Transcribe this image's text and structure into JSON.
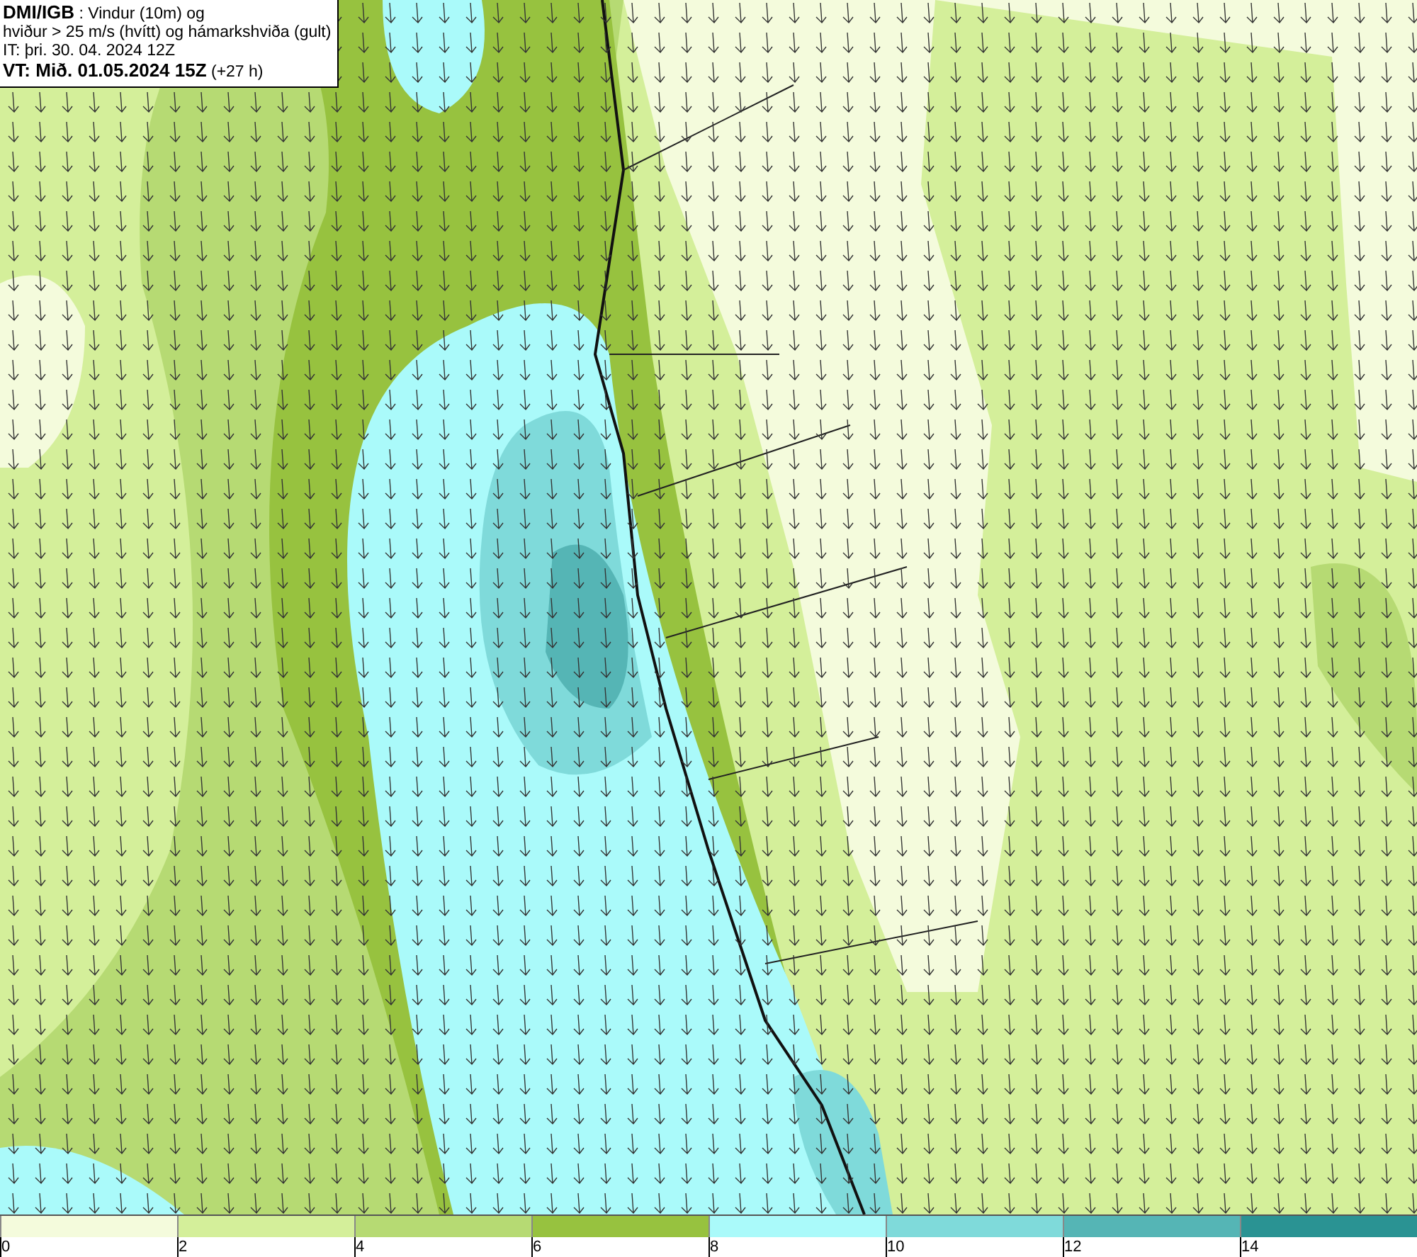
{
  "title_box": {
    "lines": [
      "**DMI/IGB** : Vindur (10m) og",
      "hviður > 25 m/s (hvítt) og hámarkshviða (gult)",
      "IT: þri. 30. 04. 2024 12Z",
      "**VT: Mið. 01.05.2024 15Z** (+27 h)"
    ]
  },
  "legend": {
    "segments": [
      {
        "color": "#f4fbdc"
      },
      {
        "color": "#d4ef9a"
      },
      {
        "color": "#b6da73"
      },
      {
        "color": "#97c23f"
      },
      {
        "color": "#aafafa"
      },
      {
        "color": "#7fdada"
      },
      {
        "color": "#55b5b5"
      },
      {
        "color": "#2a9393"
      }
    ],
    "ticks": [
      "0",
      "2",
      "4",
      "6",
      "8",
      "10",
      "12",
      "14"
    ]
  }
}
